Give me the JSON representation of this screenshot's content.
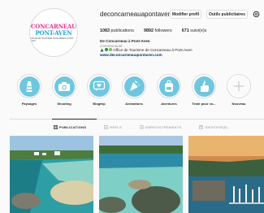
{
  "profile": {
    "username": "deconcarneauapontaven",
    "logo_line1": "CONCARNEAU",
    "logo_line2": "PONT-AVEN",
    "logo_sub": "OFFICE DE TOURISME CONCARNEAU PONT-AVEN"
  },
  "buttons": {
    "edit_label": "Modifier profil",
    "ads_label": "Outils publicitaires"
  },
  "stats": {
    "publications_count": "1083",
    "publications_label": "publications",
    "followers_count": "9892",
    "followers_label": "followers",
    "following_count": "671",
    "following_label": "suivi(e)s"
  },
  "bio": {
    "name": "De Concarneau à Pont-Aven",
    "category": "Communauté",
    "line": "Office de Tourisme de Concarneau à Pont-Aven",
    "link": "www.deconcarneauapontaven.com"
  },
  "highlights": [
    {
      "label": "Paysages",
      "icon": "lighthouse-icon"
    },
    {
      "label": "Shooting",
      "icon": "camera-icon"
    },
    {
      "label": "Blogtrip",
      "icon": "heart-message-icon"
    },
    {
      "label": "Animations",
      "icon": "party-icon"
    },
    {
      "label": "Aventures",
      "icon": "backpack-icon"
    },
    {
      "label": "Testé pour vo...",
      "icon": "thumbs-up-icon"
    },
    {
      "label": "Nouveau",
      "icon": "plus-icon"
    }
  ],
  "tabs": {
    "publications": "PUBLICATIONS",
    "reels": "REELS",
    "saved": "ENREGISTREMENTS",
    "tagged": "IDENTIFIÉ(E)"
  },
  "colors": {
    "highlight_bg": "#6fc7df",
    "link": "#00376b",
    "logo_pink": "#e8368f",
    "logo_blue": "#1fa5d6"
  }
}
